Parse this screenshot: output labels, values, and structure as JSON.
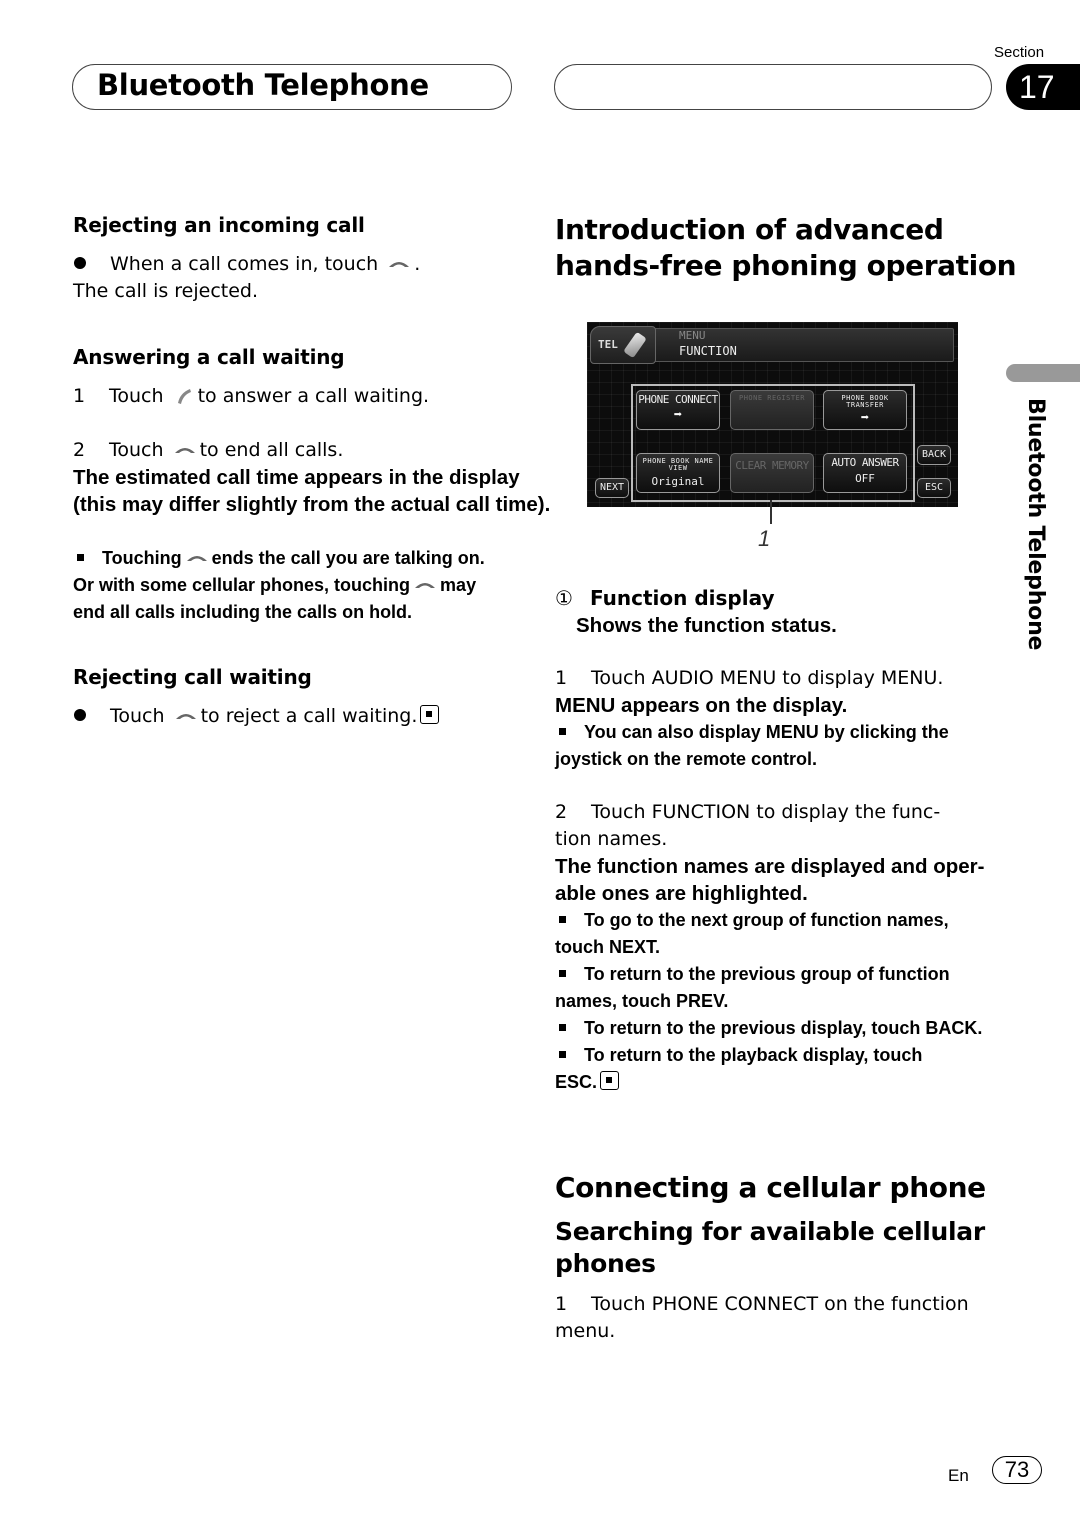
{
  "header": {
    "title": "Bluetooth Telephone",
    "section_label": "Section",
    "section_number": "17"
  },
  "left_column": {
    "rejecting_incoming": {
      "heading": "Rejecting an incoming call",
      "bullet_before": "When a call comes in, touch",
      "bullet_after": ".",
      "result": "The call is rejected."
    },
    "answering_waiting": {
      "heading": "Answering a call waiting",
      "step1_num": "1",
      "step1_before": "Touch",
      "step1_after": "to answer a call waiting.",
      "step2_num": "2",
      "step2_before": "Touch",
      "step2_after": "to end all calls.",
      "step2_body": "The estimated call time appears in the display (this may differ slightly from the actual call time).",
      "note_before": "Touching",
      "note_after": "ends the call you are talking on.",
      "note_line2_before": "Or with some cellular phones, touching",
      "note_line2_after": "may",
      "note_line3": "end all calls including the calls on hold."
    },
    "rejecting_waiting": {
      "heading": "Rejecting call waiting",
      "bullet_before": "Touch",
      "bullet_after": "to reject a call waiting."
    }
  },
  "right_column": {
    "intro_heading_line1": "Introduction of advanced",
    "intro_heading_line2": "hands-free phoning operation",
    "screen": {
      "tel_label": "TEL",
      "menu_label": "MENU",
      "function_label": "FUNCTION",
      "buttons": [
        {
          "line1": "PHONE CONNECT",
          "line2": "➡",
          "enabled": true
        },
        {
          "line1": "PHONE REGISTER",
          "line2": "",
          "enabled": false
        },
        {
          "line1": "PHONE BOOK TRANSFER",
          "line2": "➡",
          "enabled": true
        },
        {
          "line1": "PHONE BOOK NAME VIEW",
          "line2": "Original",
          "enabled": true
        },
        {
          "line1": "CLEAR MEMORY",
          "line2": "",
          "enabled": false
        },
        {
          "line1": "AUTO ANSWER",
          "line2": "OFF",
          "enabled": true
        }
      ],
      "next_label": "NEXT",
      "back_label": "BACK",
      "esc_label": "ESC",
      "callout": "1"
    },
    "legend": {
      "marker": "①",
      "title": "Function display",
      "desc": "Shows the function status."
    },
    "step1": {
      "num": "1",
      "text": "Touch AUDIO MENU to display MENU.",
      "body": "MENU appears on the display.",
      "note_line1": "You can also display MENU by clicking the",
      "note_line2": "joystick on the remote control."
    },
    "step2": {
      "num": "2",
      "text_line1": "Touch FUNCTION to display the func-",
      "text_line2": "tion names.",
      "body_line1": "The function names are displayed and oper-",
      "body_line2": "able ones are highlighted.",
      "notes": [
        {
          "line1": "To go to the next group of function names,",
          "line2": "touch NEXT."
        },
        {
          "line1": "To return to the previous group of function",
          "line2": "names, touch PREV."
        },
        {
          "line1": "To return to the previous display, touch BACK.",
          "line2": ""
        },
        {
          "line1": "To return to the playback display, touch",
          "line2": "ESC."
        }
      ]
    },
    "connecting_heading": "Connecting a cellular phone",
    "searching_heading_line1": "Searching for available cellular",
    "searching_heading_line2": "phones",
    "connect_step1_num": "1",
    "connect_step1_line1": "Touch PHONE CONNECT on the function",
    "connect_step1_line2": "menu."
  },
  "side_tab": {
    "label": "Bluetooth Telephone"
  },
  "footer": {
    "language": "En",
    "page_number": "73"
  }
}
